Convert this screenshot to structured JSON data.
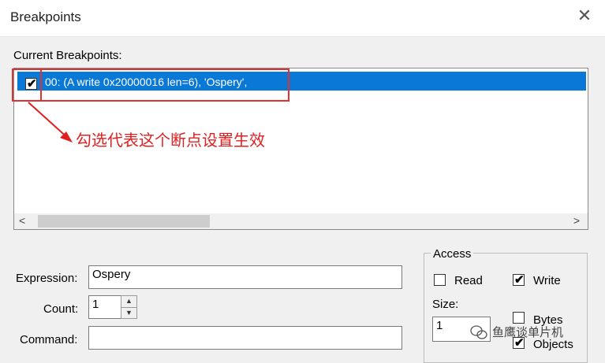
{
  "window": {
    "title": "Breakpoints"
  },
  "list": {
    "label": "Current Breakpoints:",
    "items": [
      {
        "text": "00: (A write 0x20000016 len=6),  'Ospery',",
        "checked": true,
        "selected": true
      }
    ]
  },
  "annotation": {
    "text": "勾选代表这个断点设置生效"
  },
  "fields": {
    "expression_label": "Expression:",
    "expression_value": "Ospery",
    "count_label": "Count:",
    "count_value": "1",
    "command_label": "Command:",
    "command_value": ""
  },
  "access": {
    "title": "Access",
    "read_label": "Read",
    "read_checked": false,
    "write_label": "Write",
    "write_checked": true,
    "size_label": "Size:",
    "size_value": "1",
    "bytes_label": "Bytes",
    "bytes_checked": false,
    "objects_label": "Objects",
    "objects_checked": true
  },
  "watermark": {
    "text": "鱼鹰谈单片机"
  },
  "colors": {
    "selection": "#0a78d7",
    "annotation": "#e02020"
  }
}
